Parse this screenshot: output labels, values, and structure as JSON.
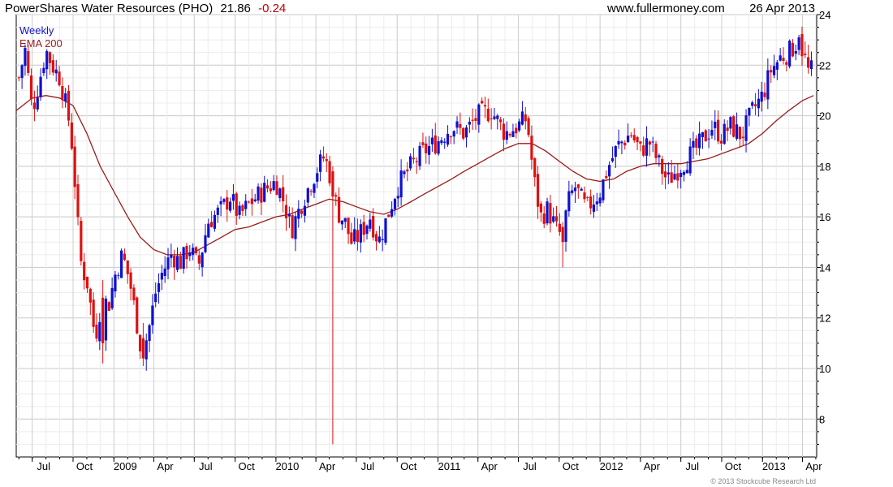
{
  "header": {
    "title": "PowerShares Water Resources (PHO)",
    "last_price": "21.86",
    "change": "-0.24",
    "source": "www.fullermoney.com",
    "date": "26 Apr 2013"
  },
  "legend": {
    "weekly": "Weekly",
    "ema": "EMA 200"
  },
  "copyright": "© 2013 Stockcube Research Ltd",
  "colors": {
    "up": "#1010d0",
    "down": "#e01010",
    "ema": "#9b1b1b",
    "grid": "#d8d8d8",
    "axis": "#000000",
    "change": "#c00000"
  },
  "chart_data": {
    "type": "candlestick",
    "interval": "Weekly",
    "ylim": [
      6.5,
      24
    ],
    "yticks": [
      8,
      10,
      12,
      14,
      16,
      18,
      20,
      22,
      24
    ],
    "xlim": [
      "2008-05-26",
      "2013-05-03"
    ],
    "xticks": [
      {
        "label": "Jul",
        "date": "2008-07-01"
      },
      {
        "label": "Oct",
        "date": "2008-10-01"
      },
      {
        "label": "2009",
        "date": "2009-01-01"
      },
      {
        "label": "Apr",
        "date": "2009-04-01"
      },
      {
        "label": "Jul",
        "date": "2009-07-01"
      },
      {
        "label": "Oct",
        "date": "2009-10-01"
      },
      {
        "label": "2010",
        "date": "2010-01-01"
      },
      {
        "label": "Apr",
        "date": "2010-04-01"
      },
      {
        "label": "Jul",
        "date": "2010-07-01"
      },
      {
        "label": "Oct",
        "date": "2010-10-01"
      },
      {
        "label": "2011",
        "date": "2011-01-01"
      },
      {
        "label": "Apr",
        "date": "2011-04-01"
      },
      {
        "label": "Jul",
        "date": "2011-07-01"
      },
      {
        "label": "Oct",
        "date": "2011-10-01"
      },
      {
        "label": "2012",
        "date": "2012-01-01"
      },
      {
        "label": "Apr",
        "date": "2012-04-01"
      },
      {
        "label": "Jul",
        "date": "2012-07-01"
      },
      {
        "label": "Oct",
        "date": "2012-10-01"
      },
      {
        "label": "2013",
        "date": "2013-01-01"
      },
      {
        "label": "Apr",
        "date": "2013-04-01"
      }
    ],
    "price_path": [
      [
        "2008-06-01",
        21.5
      ],
      [
        "2008-06-15",
        22.6
      ],
      [
        "2008-07-01",
        20.2
      ],
      [
        "2008-07-15",
        21.2
      ],
      [
        "2008-08-01",
        22.6
      ],
      [
        "2008-08-15",
        22.0
      ],
      [
        "2008-09-01",
        21.5
      ],
      [
        "2008-09-20",
        20.0
      ],
      [
        "2008-10-01",
        18.5
      ],
      [
        "2008-10-10",
        16.0
      ],
      [
        "2008-10-20",
        14.0
      ],
      [
        "2008-11-01",
        13.5
      ],
      [
        "2008-11-20",
        11.2
      ],
      [
        "2008-12-05",
        12.8
      ],
      [
        "2008-12-20",
        12.5
      ],
      [
        "2009-01-05",
        13.8
      ],
      [
        "2009-01-20",
        14.5
      ],
      [
        "2009-02-05",
        13.5
      ],
      [
        "2009-02-20",
        12.0
      ],
      [
        "2009-03-05",
        10.5
      ],
      [
        "2009-03-20",
        11.5
      ],
      [
        "2009-04-05",
        13.0
      ],
      [
        "2009-04-20",
        13.8
      ],
      [
        "2009-05-10",
        14.5
      ],
      [
        "2009-06-01",
        14.2
      ],
      [
        "2009-06-20",
        14.8
      ],
      [
        "2009-07-10",
        14.0
      ],
      [
        "2009-08-01",
        15.8
      ],
      [
        "2009-09-01",
        16.3
      ],
      [
        "2009-09-20",
        16.8
      ],
      [
        "2009-10-10",
        16.0
      ],
      [
        "2009-11-01",
        16.5
      ],
      [
        "2009-12-01",
        17.0
      ],
      [
        "2010-01-01",
        17.4
      ],
      [
        "2010-01-15",
        16.8
      ],
      [
        "2010-02-05",
        15.5
      ],
      [
        "2010-03-01",
        16.6
      ],
      [
        "2010-04-01",
        17.8
      ],
      [
        "2010-04-20",
        18.4
      ],
      [
        "2010-05-05",
        17.5
      ],
      [
        "2010-05-20",
        16.2
      ],
      [
        "2010-06-05",
        15.8
      ],
      [
        "2010-06-20",
        15.0
      ],
      [
        "2010-07-05",
        15.2
      ],
      [
        "2010-08-01",
        16.0
      ],
      [
        "2010-08-20",
        15.0
      ],
      [
        "2010-09-05",
        15.8
      ],
      [
        "2010-10-01",
        17.2
      ],
      [
        "2010-11-01",
        18.0
      ],
      [
        "2010-12-01",
        18.6
      ],
      [
        "2011-01-01",
        19.0
      ],
      [
        "2011-02-01",
        19.6
      ],
      [
        "2011-03-01",
        19.3
      ],
      [
        "2011-04-01",
        20.0
      ],
      [
        "2011-05-01",
        20.2
      ],
      [
        "2011-06-01",
        19.3
      ],
      [
        "2011-07-01",
        19.6
      ],
      [
        "2011-07-20",
        19.9
      ],
      [
        "2011-08-05",
        17.5
      ],
      [
        "2011-08-20",
        16.0
      ],
      [
        "2011-09-05",
        16.3
      ],
      [
        "2011-09-25",
        15.5
      ],
      [
        "2011-10-08",
        15.2
      ],
      [
        "2011-10-20",
        16.5
      ],
      [
        "2011-11-05",
        17.2
      ],
      [
        "2011-12-01",
        16.3
      ],
      [
        "2012-01-01",
        17.0
      ],
      [
        "2012-01-20",
        18.0
      ],
      [
        "2012-02-10",
        18.8
      ],
      [
        "2012-03-10",
        19.3
      ],
      [
        "2012-04-01",
        18.6
      ],
      [
        "2012-04-20",
        19.0
      ],
      [
        "2012-05-10",
        18.2
      ],
      [
        "2012-06-01",
        17.4
      ],
      [
        "2012-06-20",
        17.8
      ],
      [
        "2012-07-10",
        18.2
      ],
      [
        "2012-08-10",
        18.8
      ],
      [
        "2012-09-10",
        19.6
      ],
      [
        "2012-10-01",
        19.2
      ],
      [
        "2012-10-20",
        19.6
      ],
      [
        "2012-11-15",
        19.2
      ],
      [
        "2012-12-10",
        20.2
      ],
      [
        "2013-01-01",
        20.8
      ],
      [
        "2013-01-20",
        21.8
      ],
      [
        "2013-02-10",
        22.3
      ],
      [
        "2013-03-01",
        22.5
      ],
      [
        "2013-03-20",
        22.9
      ],
      [
        "2013-04-01",
        22.6
      ],
      [
        "2013-04-15",
        21.7
      ],
      [
        "2013-04-26",
        21.86
      ]
    ],
    "ema_path": [
      [
        "2008-05-26",
        20.2
      ],
      [
        "2008-07-01",
        20.7
      ],
      [
        "2008-08-01",
        20.8
      ],
      [
        "2008-09-01",
        20.7
      ],
      [
        "2008-10-01",
        20.4
      ],
      [
        "2008-11-01",
        19.3
      ],
      [
        "2008-12-01",
        18.0
      ],
      [
        "2009-01-01",
        17.0
      ],
      [
        "2009-02-01",
        16.0
      ],
      [
        "2009-03-01",
        15.2
      ],
      [
        "2009-04-01",
        14.7
      ],
      [
        "2009-05-01",
        14.5
      ],
      [
        "2009-06-01",
        14.5
      ],
      [
        "2009-07-01",
        14.6
      ],
      [
        "2009-08-01",
        14.9
      ],
      [
        "2009-09-01",
        15.2
      ],
      [
        "2009-10-01",
        15.5
      ],
      [
        "2009-11-01",
        15.6
      ],
      [
        "2009-12-01",
        15.8
      ],
      [
        "2010-01-01",
        16.0
      ],
      [
        "2010-02-01",
        16.1
      ],
      [
        "2010-03-01",
        16.3
      ],
      [
        "2010-04-01",
        16.5
      ],
      [
        "2010-05-01",
        16.7
      ],
      [
        "2010-06-01",
        16.6
      ],
      [
        "2010-07-01",
        16.4
      ],
      [
        "2010-08-01",
        16.2
      ],
      [
        "2010-09-01",
        16.1
      ],
      [
        "2010-10-01",
        16.3
      ],
      [
        "2010-11-01",
        16.6
      ],
      [
        "2010-12-01",
        16.9
      ],
      [
        "2011-01-01",
        17.2
      ],
      [
        "2011-02-01",
        17.5
      ],
      [
        "2011-03-01",
        17.8
      ],
      [
        "2011-04-01",
        18.1
      ],
      [
        "2011-05-01",
        18.4
      ],
      [
        "2011-06-01",
        18.7
      ],
      [
        "2011-07-01",
        18.9
      ],
      [
        "2011-08-01",
        18.9
      ],
      [
        "2011-09-01",
        18.6
      ],
      [
        "2011-10-01",
        18.2
      ],
      [
        "2011-11-01",
        17.8
      ],
      [
        "2011-12-01",
        17.5
      ],
      [
        "2012-01-01",
        17.4
      ],
      [
        "2012-02-01",
        17.5
      ],
      [
        "2012-03-01",
        17.8
      ],
      [
        "2012-04-01",
        18.0
      ],
      [
        "2012-05-01",
        18.1
      ],
      [
        "2012-06-01",
        18.1
      ],
      [
        "2012-07-01",
        18.1
      ],
      [
        "2012-08-01",
        18.2
      ],
      [
        "2012-09-01",
        18.3
      ],
      [
        "2012-10-01",
        18.5
      ],
      [
        "2012-11-01",
        18.7
      ],
      [
        "2012-12-01",
        18.9
      ],
      [
        "2013-01-01",
        19.3
      ],
      [
        "2013-02-01",
        19.8
      ],
      [
        "2013-03-01",
        20.2
      ],
      [
        "2013-04-01",
        20.6
      ],
      [
        "2013-04-26",
        20.8
      ]
    ],
    "notable_candles": [
      {
        "date": "2010-05-07",
        "high": 18.0,
        "low": 7.0,
        "open": 17.8,
        "close": 16.8
      },
      {
        "date": "2008-12-05",
        "high": 13.5,
        "low": 10.2,
        "open": 12.8,
        "close": 11.0
      },
      {
        "date": "2009-03-06",
        "high": 11.8,
        "low": 10.1,
        "open": 11.2,
        "close": 10.4
      },
      {
        "date": "2011-10-07",
        "high": 15.8,
        "low": 14.0,
        "open": 15.6,
        "close": 15.0
      },
      {
        "date": "2013-03-22",
        "high": 23.2,
        "low": 22.4,
        "open": 22.6,
        "close": 23.1
      },
      {
        "date": "2013-04-26",
        "high": 22.3,
        "low": 21.4,
        "open": 22.1,
        "close": 21.86
      }
    ]
  }
}
